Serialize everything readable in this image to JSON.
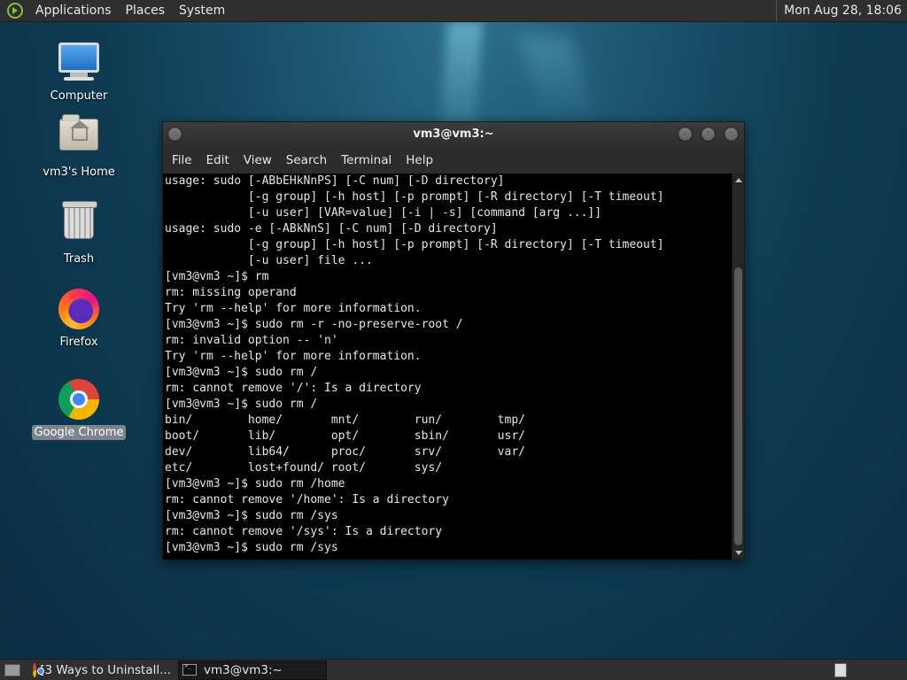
{
  "top_panel": {
    "menus": [
      "Applications",
      "Places",
      "System"
    ],
    "clock": "Mon Aug 28, 18:06"
  },
  "desktop_icons": [
    {
      "label": "Computer",
      "icon": "computer-icon"
    },
    {
      "label": "vm3's Home",
      "icon": "home-folder-icon"
    },
    {
      "label": "Trash",
      "icon": "trash-icon"
    },
    {
      "label": "Firefox",
      "icon": "firefox-icon"
    },
    {
      "label": "Google Chrome",
      "icon": "chrome-icon",
      "selected": true
    }
  ],
  "terminal": {
    "title": "vm3@vm3:~",
    "menu": [
      "File",
      "Edit",
      "View",
      "Search",
      "Terminal",
      "Help"
    ],
    "lines": [
      "usage: sudo [-ABbEHkNnPS] [-C num] [-D directory]",
      "            [-g group] [-h host] [-p prompt] [-R directory] [-T timeout]",
      "            [-u user] [VAR=value] [-i | -s] [command [arg ...]]",
      "usage: sudo -e [-ABkNnS] [-C num] [-D directory]",
      "            [-g group] [-h host] [-p prompt] [-R directory] [-T timeout]",
      "            [-u user] file ...",
      "[vm3@vm3 ~]$ rm",
      "rm: missing operand",
      "Try 'rm --help' for more information.",
      "[vm3@vm3 ~]$ sudo rm -r -no-preserve-root /",
      "rm: invalid option -- 'n'",
      "Try 'rm --help' for more information.",
      "[vm3@vm3 ~]$ sudo rm /",
      "rm: cannot remove '/': Is a directory",
      "[vm3@vm3 ~]$ sudo rm /",
      "bin/        home/       mnt/        run/        tmp/",
      "boot/       lib/        opt/        sbin/       usr/",
      "dev/        lib64/      proc/       srv/        var/",
      "etc/        lost+found/ root/       sys/",
      "[vm3@vm3 ~]$ sudo rm /home",
      "rm: cannot remove '/home': Is a directory",
      "[vm3@vm3 ~]$ sudo rm /sys",
      "rm: cannot remove '/sys': Is a directory",
      "[vm3@vm3 ~]$ sudo rm /sys"
    ]
  },
  "taskbar": {
    "tasks": [
      {
        "label": "[3 Ways to Uninstall...",
        "icon": "chrome-icon",
        "active": false
      },
      {
        "label": "vm3@vm3:~",
        "icon": "terminal-icon",
        "active": true
      }
    ]
  }
}
